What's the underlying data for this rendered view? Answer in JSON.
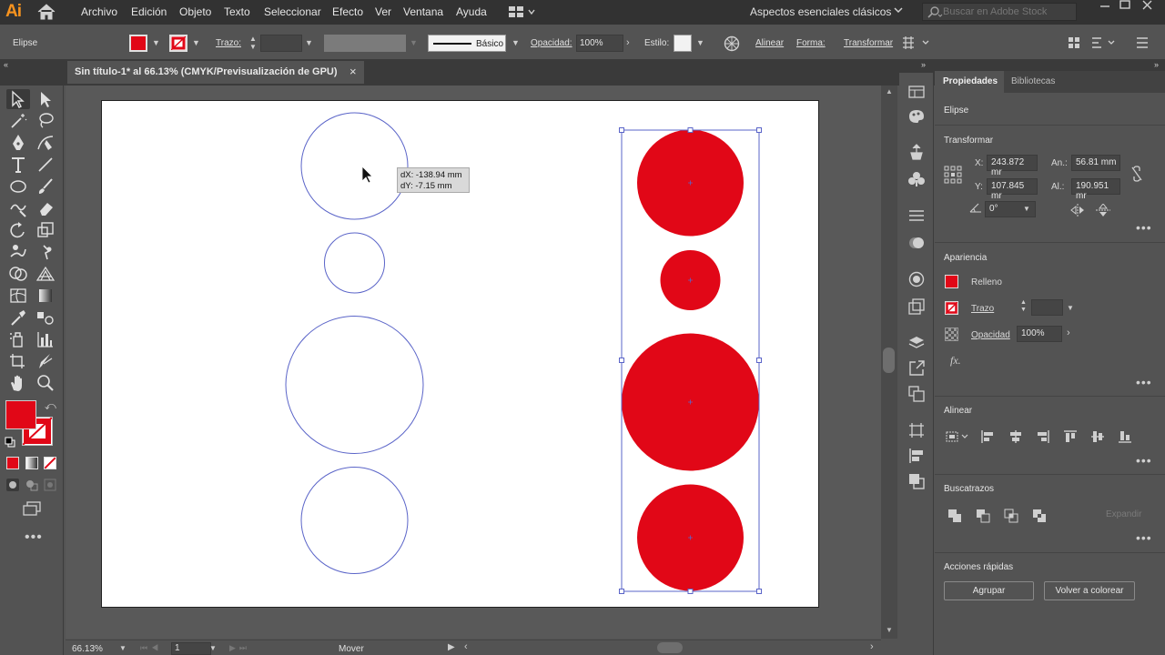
{
  "app": {
    "logo": "Ai"
  },
  "menu": [
    "Archivo",
    "Edición",
    "Objeto",
    "Texto",
    "Seleccionar",
    "Efecto",
    "Ver",
    "Ventana",
    "Ayuda"
  ],
  "workspace": "Aspectos esenciales clásicos",
  "search": {
    "placeholder": "Buscar en Adobe Stock"
  },
  "control": {
    "selection_label": "Elipse",
    "stroke_label": "Trazo:",
    "brush_label": "Básico",
    "opacity_label": "Opacidad:",
    "opacity_value": "100%",
    "style_label": "Estilo:",
    "align_label": "Alinear",
    "shape_label": "Forma:",
    "transform_label": "Transformar"
  },
  "document": {
    "tab_title": "Sin título-1* al 66.13% (CMYK/Previsualización de GPU)",
    "close": "×"
  },
  "tooltip": {
    "dx": "dX: -138.94 mm",
    "dy": "dY: -7.15 mm"
  },
  "status": {
    "zoom": "66.13%",
    "artboard": "1",
    "action": "Mover"
  },
  "panel": {
    "tabs": [
      "Propiedades",
      "Bibliotecas"
    ],
    "selection": "Elipse",
    "transform": {
      "title": "Transformar",
      "x_label": "X:",
      "x": "243.872 mr",
      "y_label": "Y:",
      "y": "107.845 mr",
      "w_label": "An.:",
      "w": "56.81 mm",
      "h_label": "Al.:",
      "h": "190.951 mr",
      "angle": "0°"
    },
    "appearance": {
      "title": "Apariencia",
      "fill_label": "Relleno",
      "stroke_label": "Trazo",
      "opacity_label": "Opacidad",
      "opacity_value": "100%",
      "fx": "fx."
    },
    "align": {
      "title": "Alinear"
    },
    "pathfinder": {
      "title": "Buscatrazos",
      "expand": "Expandir"
    },
    "quick_actions": {
      "title": "Acciones rápidas",
      "group": "Agrupar",
      "recolor": "Volver a colorear"
    }
  },
  "colors": {
    "fill": "#e10717",
    "accent": "#f7931e",
    "outline": "#5a64c8"
  }
}
